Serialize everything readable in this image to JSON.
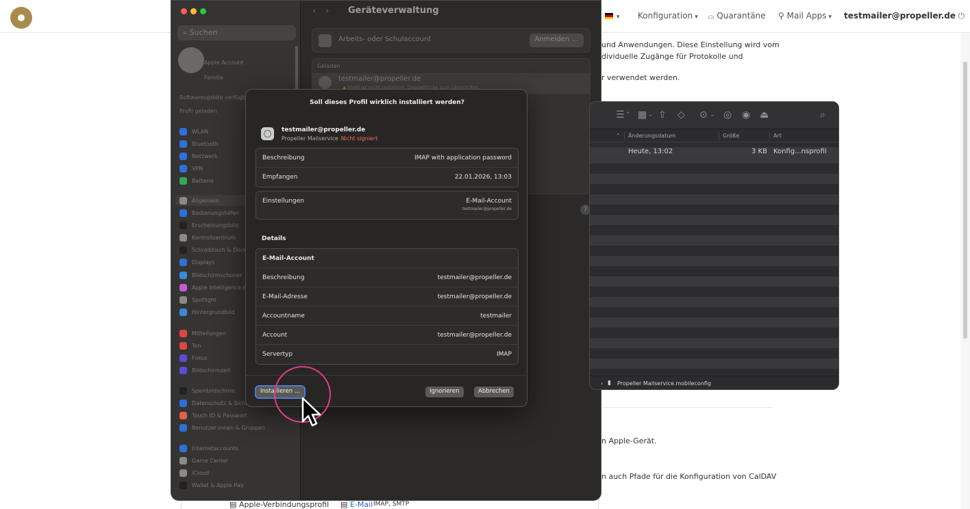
{
  "web": {
    "nav": {
      "konfiguration": "Konfiguration",
      "quarantaene": "Quarantäne",
      "mail_apps": "Mail Apps",
      "user": "testmailer@propeller.de"
    },
    "text_lines": [
      "und Anwendungen. Diese Einstellung wird vom",
      "dividuelle Zugänge für Protokolle und",
      "r verwendet werden.",
      "n Apple-Gerät.",
      "n auch Pfade für die Konfiguration von CalDAV"
    ],
    "bottom": {
      "profile": "Apple-Verbindungsprofil",
      "email": "E-Mail",
      "protocols": "IMAP, SMTP"
    }
  },
  "settings": {
    "title": "Geräteverwaltung",
    "search_placeholder": "Suchen",
    "account_sub": "Apple Account",
    "family": "Familie",
    "update_note": "Softwareupdate verfügbar",
    "profile_note": "Profil geladen",
    "sidebar_items": [
      {
        "label": "WLAN",
        "color": "#2f6fd8"
      },
      {
        "label": "Bluetooth",
        "color": "#2f6fd8"
      },
      {
        "label": "Netzwerk",
        "color": "#2f6fd8"
      },
      {
        "label": "VPN",
        "color": "#2f6fd8"
      },
      {
        "label": "Batterie",
        "color": "#34a853"
      },
      {
        "label": "Allgemein",
        "color": "#8a8a8a"
      },
      {
        "label": "Bedienungshilfen",
        "color": "#2f6fd8"
      },
      {
        "label": "Erscheinungsbild",
        "color": "#222222"
      },
      {
        "label": "Kontrollzentrum",
        "color": "#8a8a8a"
      },
      {
        "label": "Schreibtisch & Dock",
        "color": "#222222"
      },
      {
        "label": "Displays",
        "color": "#2f6fd8"
      },
      {
        "label": "Bildschirmschoner",
        "color": "#3a8ad8"
      },
      {
        "label": "Apple Intelligence & Siri",
        "color": "#c35bd8"
      },
      {
        "label": "Spotlight",
        "color": "#8a8a8a"
      },
      {
        "label": "Hintergrundbild",
        "color": "#3a8ad8"
      },
      {
        "label": "Mitteilungen",
        "color": "#e04444"
      },
      {
        "label": "Ton",
        "color": "#e04444"
      },
      {
        "label": "Fokus",
        "color": "#5b4bd8"
      },
      {
        "label": "Bildschirmzeit",
        "color": "#5b4bd8"
      },
      {
        "label": "Sperrbildschirm",
        "color": "#222222"
      },
      {
        "label": "Datenschutz & Sicherheit",
        "color": "#2f6fd8"
      },
      {
        "label": "Touch ID & Passwort",
        "color": "#e0604a"
      },
      {
        "label": "Benutzer:innen & Gruppen",
        "color": "#2f6fd8"
      },
      {
        "label": "Internetaccounts",
        "color": "#2f6fd8"
      },
      {
        "label": "Game Center",
        "color": "#8a8a8a"
      },
      {
        "label": "iCloud",
        "color": "#8a8a8a"
      },
      {
        "label": "Wallet & Apple Pay",
        "color": "#222222"
      }
    ],
    "work_account": "Arbeits- oder Schulaccount",
    "sign_in": "Anmelden ...",
    "loaded": "Geladen",
    "loaded_profile": "testmailer@propeller.de",
    "loaded_warning": "Profil ist nicht installiert. Doppelklicke zum Überprüfen.",
    "help": "?"
  },
  "finder": {
    "columns": {
      "modified": "Änderungsdatum",
      "size": "Größe",
      "kind": "Art"
    },
    "file": {
      "modified": "Heute, 13:02",
      "size": "3 KB",
      "kind": "Konfig...nsprofil"
    },
    "path": "Propeller Mailservice.mobileconfig"
  },
  "dialog": {
    "title": "Soll dieses Profil wirklich installiert werden?",
    "profile_name": "testmailer@propeller.de",
    "profile_org": "Propeller Mailservice",
    "not_signed": "Nicht signiert",
    "info": {
      "beschreibung_k": "Beschreibung",
      "beschreibung_v": "IMAP with application password",
      "empfangen_k": "Empfangen",
      "empfangen_v": "22.01.2026, 13:03"
    },
    "settings": {
      "k": "Einstellungen",
      "v": "E-Mail-Account",
      "v2": "testmailer@propeller.de"
    },
    "details_label": "Details",
    "details": {
      "header": "E-Mail-Account",
      "rows": [
        {
          "k": "Beschreibung",
          "v": "testmailer@propeller.de"
        },
        {
          "k": "E-Mail-Adresse",
          "v": "testmailer@propeller.de"
        },
        {
          "k": "Accountname",
          "v": "testmailer"
        },
        {
          "k": "Account",
          "v": "testmailer@propeller.de"
        },
        {
          "k": "Servertyp",
          "v": "IMAP"
        }
      ]
    },
    "buttons": {
      "install": "Installieren ...",
      "ignore": "Ignorieren",
      "cancel": "Abbrechen"
    }
  },
  "accent": {
    "click_highlight": "#e53a8f",
    "warning": "#ff6a5a"
  }
}
